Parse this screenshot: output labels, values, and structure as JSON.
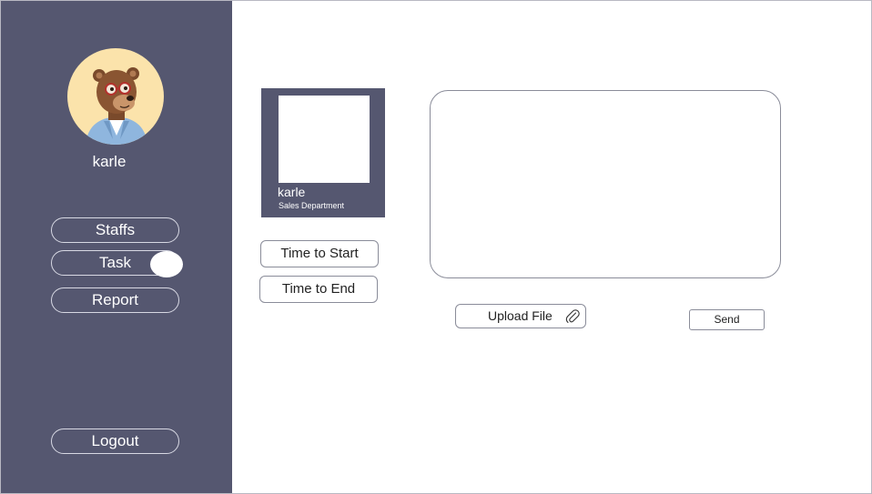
{
  "sidebar": {
    "username": "karle",
    "avatar_icon": "bear-avatar-icon",
    "nav": {
      "staffs": "Staffs",
      "task": "Task",
      "report": "Report"
    },
    "logout": "Logout"
  },
  "profile_card": {
    "name": "karle",
    "department": "Sales Department"
  },
  "time": {
    "start_label": "Time to Start",
    "end_label": "Time to End"
  },
  "composer": {
    "message_value": "",
    "upload_label": "Upload File",
    "upload_icon": "paperclip-icon",
    "send_label": "Send"
  },
  "colors": {
    "sidebar_bg": "#555770",
    "avatar_bg": "#fbe3ab"
  }
}
